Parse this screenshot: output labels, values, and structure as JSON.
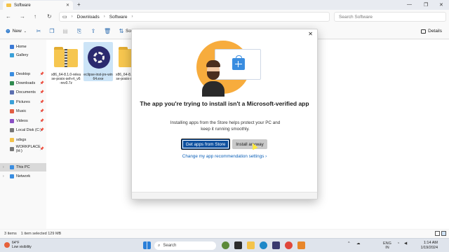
{
  "window": {
    "tab_title": "Software",
    "new_tab": "+",
    "controls": [
      "—",
      "❐",
      "✕"
    ]
  },
  "address": {
    "segments": [
      "Downloads",
      "Software"
    ],
    "search_placeholder": "Search Software"
  },
  "command_bar": {
    "new_label": "New",
    "sort_label": "So",
    "details_label": "Details"
  },
  "sidebar": {
    "items": [
      {
        "label": "Home",
        "icon": "home-icon",
        "color": "#3b7ad6"
      },
      {
        "label": "Gallery",
        "icon": "gallery-icon",
        "color": "#3aa0d8"
      },
      {
        "label": "Desktop",
        "icon": "desktop-icon",
        "color": "#3a8de0"
      },
      {
        "label": "Downloads",
        "icon": "download-icon",
        "color": "#2f8a4f"
      },
      {
        "label": "Documents",
        "icon": "documents-icon",
        "color": "#5b6fb0"
      },
      {
        "label": "Pictures",
        "icon": "pictures-icon",
        "color": "#3aa0d8"
      },
      {
        "label": "Music",
        "icon": "music-icon",
        "color": "#e25d43"
      },
      {
        "label": "Videos",
        "icon": "videos-icon",
        "color": "#8a4fc4"
      },
      {
        "label": "Local Disk (C:)",
        "icon": "drive-icon",
        "color": "#777777"
      },
      {
        "label": "sdsgs",
        "icon": "folder-icon",
        "color": "#f4c34a"
      },
      {
        "label": "WORKPLACE (H:)",
        "icon": "drive-icon",
        "color": "#777777"
      },
      {
        "label": "This PC",
        "icon": "pc-icon",
        "color": "#3a8de0"
      },
      {
        "label": "Network",
        "icon": "network-icon",
        "color": "#3a8de0"
      }
    ]
  },
  "files": [
    {
      "name": "x86_64-8.1.0-release-posix-seh-rt_v6-rev0.7z",
      "kind": "zip"
    },
    {
      "name": "eclipse-inst-jre-win64.exe",
      "kind": "exe"
    },
    {
      "name": "x86_64-8.1.0-release-posix-seh-rt_v6",
      "kind": "folder"
    }
  ],
  "status": {
    "items": "3 items",
    "selected": "1 item selected  129 MB"
  },
  "dialog": {
    "title": "The app you're trying to install isn't a Microsoft-verified app",
    "description": "Installing apps from the Store helps protect your PC and keep it running smoothly.",
    "primary_button": "Get apps from Store",
    "secondary_button": "Install anyway",
    "link": "Change my app recommendation settings"
  },
  "taskbar": {
    "weather_temp": "64°F",
    "weather_desc": "Low visibility",
    "search_placeholder": "Search",
    "lang": "ENG",
    "region": "IN",
    "time": "1:14 AM",
    "date": "1/19/2024"
  }
}
